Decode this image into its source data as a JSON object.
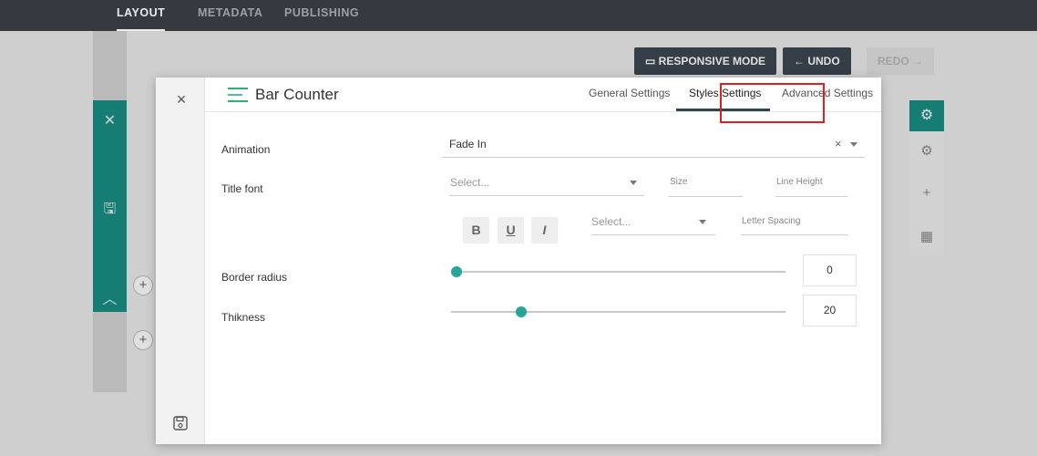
{
  "topbar": {
    "tabs": [
      {
        "label": "LAYOUT",
        "active": true
      },
      {
        "label": "METADATA",
        "active": false
      },
      {
        "label": "PUBLISHING",
        "active": false
      }
    ]
  },
  "background": {
    "responsive_mode_label": "RESPONSIVE MODE",
    "undo_label": "UNDO",
    "redo_label": "REDO",
    "accent": "#1a8f86"
  },
  "modal": {
    "title": "Bar Counter",
    "tabs": [
      {
        "label": "General Settings",
        "active": false
      },
      {
        "label": "Styles Settings",
        "active": true
      },
      {
        "label": "Advanced Settings",
        "active": false
      }
    ],
    "animation": {
      "label": "Animation",
      "value": "Fade In"
    },
    "title_font": {
      "label": "Title font",
      "font_placeholder": "Select...",
      "size_placeholder": "Size",
      "line_height_placeholder": "Line Height",
      "bold_label": "B",
      "underline_label": "U",
      "italic_label": "I",
      "style_placeholder": "Select...",
      "letter_spacing_placeholder": "Letter Spacing"
    },
    "border_radius": {
      "label": "Border radius",
      "value": "0"
    },
    "thickness": {
      "label": "Thikness",
      "value": "20"
    },
    "slider_color": "#26a69a",
    "highlight_color": "#e02020"
  }
}
